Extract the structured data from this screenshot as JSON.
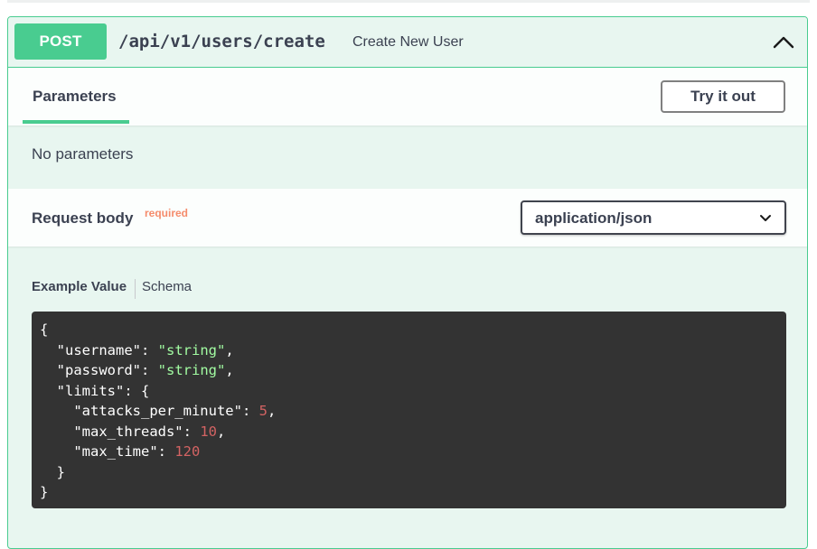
{
  "operation": {
    "method": "POST",
    "path": "/api/v1/users/create",
    "summary": "Create New User"
  },
  "parameters": {
    "tab_label": "Parameters",
    "try_button": "Try it out",
    "empty_text": "No parameters"
  },
  "request_body": {
    "title": "Request body",
    "required_label": "required",
    "content_type": "application/json"
  },
  "example": {
    "tab_example": "Example Value",
    "tab_schema": "Schema",
    "lines": [
      [
        {
          "t": "p",
          "v": "{"
        }
      ],
      [
        {
          "t": "p",
          "v": "  "
        },
        {
          "t": "k",
          "v": "\"username\""
        },
        {
          "t": "p",
          "v": ": "
        },
        {
          "t": "s",
          "v": "\"string\""
        },
        {
          "t": "p",
          "v": ","
        }
      ],
      [
        {
          "t": "p",
          "v": "  "
        },
        {
          "t": "k",
          "v": "\"password\""
        },
        {
          "t": "p",
          "v": ": "
        },
        {
          "t": "s",
          "v": "\"string\""
        },
        {
          "t": "p",
          "v": ","
        }
      ],
      [
        {
          "t": "p",
          "v": "  "
        },
        {
          "t": "k",
          "v": "\"limits\""
        },
        {
          "t": "p",
          "v": ": {"
        }
      ],
      [
        {
          "t": "p",
          "v": "    "
        },
        {
          "t": "k",
          "v": "\"attacks_per_minute\""
        },
        {
          "t": "p",
          "v": ": "
        },
        {
          "t": "n",
          "v": "5"
        },
        {
          "t": "p",
          "v": ","
        }
      ],
      [
        {
          "t": "p",
          "v": "    "
        },
        {
          "t": "k",
          "v": "\"max_threads\""
        },
        {
          "t": "p",
          "v": ": "
        },
        {
          "t": "n",
          "v": "10"
        },
        {
          "t": "p",
          "v": ","
        }
      ],
      [
        {
          "t": "p",
          "v": "    "
        },
        {
          "t": "k",
          "v": "\"max_time\""
        },
        {
          "t": "p",
          "v": ": "
        },
        {
          "t": "n",
          "v": "120"
        }
      ],
      [
        {
          "t": "p",
          "v": "  }"
        }
      ],
      [
        {
          "t": "p",
          "v": "}"
        }
      ]
    ]
  },
  "colors": {
    "post_green": "#49cc90",
    "panel_bg": "#e8f6f0",
    "required": "#f58c6c",
    "code_bg": "#333333",
    "code_string": "#a2fca2",
    "code_number": "#d36363"
  },
  "icons": {
    "collapse": "chevron-up-icon",
    "select": "chevron-down-icon"
  }
}
